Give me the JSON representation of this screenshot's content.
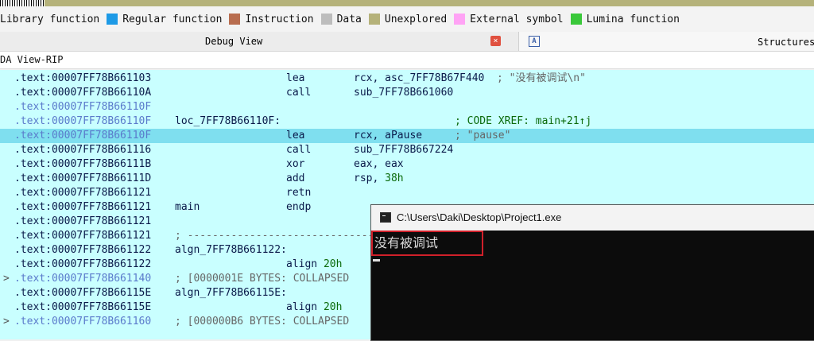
{
  "legend": [
    {
      "label": "Library function",
      "color": ""
    },
    {
      "label": "Regular function",
      "color": "#1d9ae6"
    },
    {
      "label": "Instruction",
      "color": "#b86d4f"
    },
    {
      "label": "Data",
      "color": "#bdbdbd"
    },
    {
      "label": "Unexplored",
      "color": "#b5b27a"
    },
    {
      "label": "External symbol",
      "color": "#ffa3f5"
    },
    {
      "label": "Lumina function",
      "color": "#3ac83a"
    }
  ],
  "tabs": {
    "debug_view": "Debug View",
    "structures": "Structures",
    "close_icon": "×",
    "struct_icon": "A"
  },
  "view_title": "DA View-RIP",
  "lines": [
    {
      "arrow": "",
      "addr": ".text:00007FF78B661103",
      "label": "",
      "mnem": "lea",
      "ops": "rcx, asc_7FF78B67F440",
      "cmt": "; \"没有被调试\\n\"",
      "dim": false,
      "hl": false
    },
    {
      "arrow": "",
      "addr": ".text:00007FF78B66110A",
      "label": "",
      "mnem": "call",
      "ops": "sub_7FF78B661060",
      "cmt": "",
      "dim": false,
      "hl": false
    },
    {
      "arrow": "",
      "addr": ".text:00007FF78B66110F",
      "label": "",
      "mnem": "",
      "ops": "",
      "cmt": "",
      "dim": true,
      "hl": false
    },
    {
      "arrow": "",
      "addr": ".text:00007FF78B66110F",
      "label": "loc_7FF78B66110F:",
      "mnem": "",
      "ops": "",
      "cmt": "; CODE XREF: main+21↑j",
      "dim": true,
      "hl": false
    },
    {
      "arrow": "",
      "addr": ".text:00007FF78B66110F",
      "label": "",
      "mnem": "lea",
      "ops": "rcx, aPause",
      "cmt": "; \"pause\"",
      "dim": true,
      "hl": true
    },
    {
      "arrow": "",
      "addr": ".text:00007FF78B661116",
      "label": "",
      "mnem": "call",
      "ops": "sub_7FF78B667224",
      "cmt": "",
      "dim": false,
      "hl": false
    },
    {
      "arrow": "",
      "addr": ".text:00007FF78B66111B",
      "label": "",
      "mnem": "xor",
      "ops": "eax, eax",
      "cmt": "",
      "dim": false,
      "hl": false
    },
    {
      "arrow": "",
      "addr": ".text:00007FF78B66111D",
      "label": "",
      "mnem": "add",
      "ops": "rsp, 38h",
      "cmt": "",
      "dim": false,
      "hl": false
    },
    {
      "arrow": "",
      "addr": ".text:00007FF78B661121",
      "label": "",
      "mnem": "retn",
      "ops": "",
      "cmt": "",
      "dim": false,
      "hl": false
    },
    {
      "arrow": "",
      "addr": ".text:00007FF78B661121",
      "label": "main",
      "mnem": "endp",
      "ops": "",
      "cmt": "",
      "dim": false,
      "hl": false
    },
    {
      "arrow": "",
      "addr": ".text:00007FF78B661121",
      "label": "",
      "mnem": "",
      "ops": "",
      "cmt": "",
      "dim": false,
      "hl": false
    },
    {
      "arrow": "",
      "addr": ".text:00007FF78B661121",
      "label": "; ----------------------------------------------",
      "mnem": "",
      "ops": "",
      "cmt": "",
      "dim": false,
      "hl": false
    },
    {
      "arrow": "",
      "addr": ".text:00007FF78B661122",
      "label": "algn_7FF78B661122:",
      "mnem": "",
      "ops": "",
      "cmt": "",
      "dim": false,
      "hl": false
    },
    {
      "arrow": "",
      "addr": ".text:00007FF78B661122",
      "label": "",
      "mnem": "align 20h",
      "ops": "",
      "cmt": "",
      "dim": false,
      "hl": false
    },
    {
      "arrow": ">",
      "addr": ".text:00007FF78B661140",
      "label": "; [0000001E BYTES: COLLAPSED",
      "mnem": "",
      "ops": "",
      "cmt": "",
      "dim": true,
      "hl": false
    },
    {
      "arrow": "",
      "addr": ".text:00007FF78B66115E",
      "label": "algn_7FF78B66115E:",
      "mnem": "",
      "ops": "",
      "cmt": "",
      "dim": false,
      "hl": false
    },
    {
      "arrow": "",
      "addr": ".text:00007FF78B66115E",
      "label": "",
      "mnem": "align 20h",
      "ops": "",
      "cmt": "",
      "dim": false,
      "hl": false
    },
    {
      "arrow": ">",
      "addr": ".text:00007FF78B661160",
      "label": "; [000000B6 BYTES: COLLAPSED",
      "mnem": "",
      "ops": "",
      "cmt": "",
      "dim": true,
      "hl": false
    }
  ],
  "console": {
    "title": "C:\\Users\\Daki\\Desktop\\Project1.exe",
    "output": "没有被调试"
  }
}
